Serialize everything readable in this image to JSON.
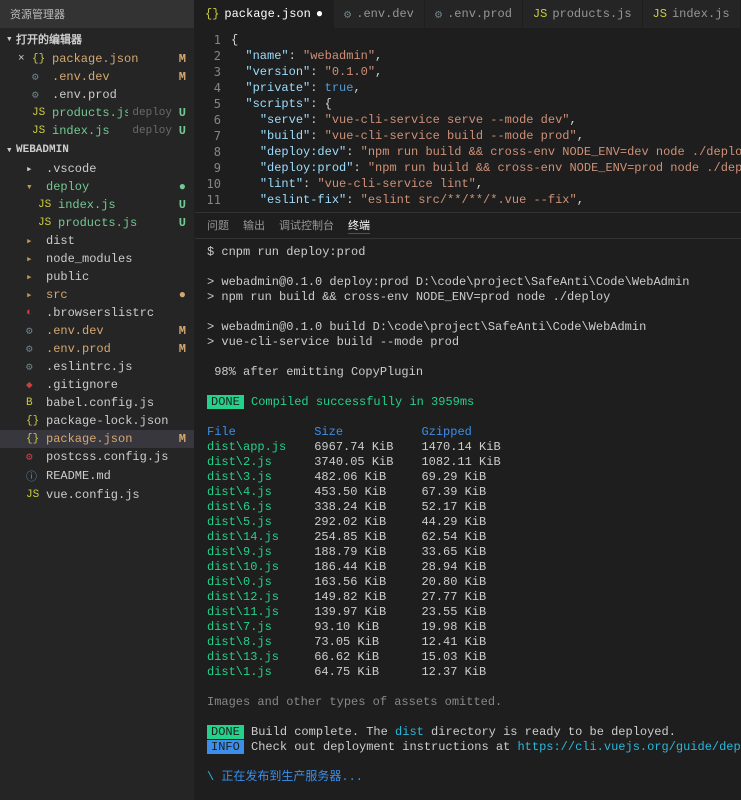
{
  "sidebar": {
    "title": "资源管理器",
    "open_editors_label": "打开的编辑器",
    "project_label": "WEBADMIN",
    "open_editors": [
      {
        "icon": "{}",
        "iconClass": "icon-json",
        "name": "package.json",
        "status": "M",
        "statusClass": "",
        "modClass": "modified",
        "close": "×",
        "suffix": ""
      },
      {
        "icon": "⚙",
        "iconClass": "icon-gear",
        "name": ".env.dev",
        "status": "M",
        "statusClass": "",
        "modClass": "modified",
        "close": "",
        "suffix": ""
      },
      {
        "icon": "⚙",
        "iconClass": "icon-gear",
        "name": ".env.prod",
        "status": "",
        "statusClass": "",
        "modClass": "",
        "close": "",
        "suffix": ""
      },
      {
        "icon": "JS",
        "iconClass": "icon-js",
        "name": "products.js",
        "suffix": "deploy",
        "status": "U",
        "statusClass": "u",
        "modClass": "untracked",
        "close": ""
      },
      {
        "icon": "JS",
        "iconClass": "icon-js",
        "name": "index.js",
        "suffix": "deploy",
        "status": "U",
        "statusClass": "u",
        "modClass": "untracked",
        "close": ""
      }
    ],
    "tree": [
      {
        "depth": "d1",
        "icon": "▸",
        "iconClass": "",
        "name": ".vscode",
        "status": "",
        "statusClass": "",
        "modClass": ""
      },
      {
        "depth": "d1",
        "icon": "▾",
        "iconClass": "icon-folder",
        "name": "deploy",
        "status": "●",
        "statusClass": "u",
        "modClass": "untracked"
      },
      {
        "depth": "d2",
        "icon": "JS",
        "iconClass": "icon-js",
        "name": "index.js",
        "status": "U",
        "statusClass": "u",
        "modClass": "untracked"
      },
      {
        "depth": "d2",
        "icon": "JS",
        "iconClass": "icon-js",
        "name": "products.js",
        "status": "U",
        "statusClass": "u",
        "modClass": "untracked"
      },
      {
        "depth": "d1",
        "icon": "▸",
        "iconClass": "icon-folder",
        "name": "dist",
        "status": "",
        "statusClass": "",
        "modClass": ""
      },
      {
        "depth": "d1",
        "icon": "▸",
        "iconClass": "icon-folder",
        "name": "node_modules",
        "status": "",
        "statusClass": "",
        "modClass": ""
      },
      {
        "depth": "d1",
        "icon": "▸",
        "iconClass": "icon-folder",
        "name": "public",
        "status": "",
        "statusClass": "",
        "modClass": ""
      },
      {
        "depth": "d1",
        "icon": "▸",
        "iconClass": "icon-folder",
        "name": "src",
        "status": "●",
        "statusClass": "",
        "modClass": "modified"
      },
      {
        "depth": "d1",
        "icon": "◐",
        "iconClass": "icon-red",
        "name": ".browserslistrc",
        "status": "",
        "statusClass": "",
        "modClass": ""
      },
      {
        "depth": "d1",
        "icon": "⚙",
        "iconClass": "icon-gear",
        "name": ".env.dev",
        "status": "M",
        "statusClass": "",
        "modClass": "modified"
      },
      {
        "depth": "d1",
        "icon": "⚙",
        "iconClass": "icon-gear",
        "name": ".env.prod",
        "status": "M",
        "statusClass": "",
        "modClass": "modified"
      },
      {
        "depth": "d1",
        "icon": "⚙",
        "iconClass": "icon-gear",
        "name": ".eslintrc.js",
        "status": "",
        "statusClass": "",
        "modClass": ""
      },
      {
        "depth": "d1",
        "icon": "◆",
        "iconClass": "icon-red",
        "name": ".gitignore",
        "status": "",
        "statusClass": "",
        "modClass": ""
      },
      {
        "depth": "d1",
        "icon": "B",
        "iconClass": "icon-js",
        "name": "babel.config.js",
        "status": "",
        "statusClass": "",
        "modClass": ""
      },
      {
        "depth": "d1",
        "icon": "{}",
        "iconClass": "icon-json",
        "name": "package-lock.json",
        "status": "",
        "statusClass": "",
        "modClass": ""
      },
      {
        "depth": "d1",
        "icon": "{}",
        "iconClass": "icon-json",
        "name": "package.json",
        "status": "M",
        "statusClass": "",
        "modClass": "modified",
        "active": true
      },
      {
        "depth": "d1",
        "icon": "⚙",
        "iconClass": "icon-red",
        "name": "postcss.config.js",
        "status": "",
        "statusClass": "",
        "modClass": ""
      },
      {
        "depth": "d1",
        "icon": "ⓘ",
        "iconClass": "icon-blue",
        "name": "README.md",
        "status": "",
        "statusClass": "",
        "modClass": ""
      },
      {
        "depth": "d1",
        "icon": "JS",
        "iconClass": "icon-js",
        "name": "vue.config.js",
        "status": "",
        "statusClass": "",
        "modClass": ""
      }
    ]
  },
  "tabs": [
    {
      "icon": "{}",
      "iconClass": "icon-json",
      "label": "package.json",
      "active": true,
      "dot": "●"
    },
    {
      "icon": "⚙",
      "iconClass": "icon-gear",
      "label": ".env.dev",
      "active": false,
      "dot": ""
    },
    {
      "icon": "⚙",
      "iconClass": "icon-gear",
      "label": ".env.prod",
      "active": false,
      "dot": ""
    },
    {
      "icon": "JS",
      "iconClass": "icon-js",
      "label": "products.js",
      "active": false,
      "dot": ""
    },
    {
      "icon": "JS",
      "iconClass": "icon-js",
      "label": "index.js",
      "active": false,
      "dot": ""
    }
  ],
  "editor": {
    "lines": [
      {
        "n": "1",
        "html": "<span class='c-punc'>{</span>"
      },
      {
        "n": "2",
        "html": "  <span class='c-key'>\"name\"</span><span class='c-punc'>: </span><span class='c-str'>\"webadmin\"</span><span class='c-punc'>,</span>"
      },
      {
        "n": "3",
        "html": "  <span class='c-key'>\"version\"</span><span class='c-punc'>: </span><span class='c-str'>\"0.1.0\"</span><span class='c-punc'>,</span>"
      },
      {
        "n": "4",
        "html": "  <span class='c-key'>\"private\"</span><span class='c-punc'>: </span><span class='c-bool'>true</span><span class='c-punc'>,</span>"
      },
      {
        "n": "5",
        "html": "  <span class='c-key'>\"scripts\"</span><span class='c-punc'>: {</span>"
      },
      {
        "n": "6",
        "html": "    <span class='c-key'>\"serve\"</span><span class='c-punc'>: </span><span class='c-str'>\"vue-cli-service serve --mode dev\"</span><span class='c-punc'>,</span>"
      },
      {
        "n": "7",
        "html": "    <span class='c-key'>\"build\"</span><span class='c-punc'>: </span><span class='c-str'>\"vue-cli-service build --mode prod\"</span><span class='c-punc'>,</span>"
      },
      {
        "n": "8",
        "html": "    <span class='c-key'>\"deploy:dev\"</span><span class='c-punc'>: </span><span class='c-str'>\"npm run build && cross-env NODE_ENV=dev node ./deploy\"</span><span class='c-punc'>,</span>"
      },
      {
        "n": "9",
        "html": "    <span class='c-key'>\"deploy:prod\"</span><span class='c-punc'>: </span><span class='c-str'>\"npm run build && cross-env NODE_ENV=prod node ./deploy\"</span><span class='c-punc'>,</span>"
      },
      {
        "n": "10",
        "html": "    <span class='c-key'>\"lint\"</span><span class='c-punc'>: </span><span class='c-str'>\"vue-cli-service lint\"</span><span class='c-punc'>,</span>"
      },
      {
        "n": "11",
        "html": "    <span class='c-key'>\"eslint-fix\"</span><span class='c-punc'>: </span><span class='c-str'>\"eslint src/**/**/*.vue --fix\"</span><span class='c-punc'>,</span>"
      }
    ]
  },
  "terminal_tabs": {
    "t1": "问题",
    "t2": "输出",
    "t3": "调试控制台",
    "t4": "终端"
  },
  "terminal": {
    "cmd": "$ cnpm run deploy:prod",
    "line1": "> webadmin@0.1.0 deploy:prod D:\\code\\project\\SafeAnti\\Code\\WebAdmin",
    "line2": "> npm run build && cross-env NODE_ENV=prod node ./deploy",
    "line3": "> webadmin@0.1.0 build D:\\code\\project\\SafeAnti\\Code\\WebAdmin",
    "line4": "> vue-cli-service build --mode prod",
    "progress": " 98% after emitting CopyPlugin",
    "done_label": "DONE",
    "compiled": " Compiled successfully in 3959ms",
    "header_file": "File",
    "header_size": "Size",
    "header_gzip": "Gzipped",
    "files": [
      {
        "f": "dist\\app.js",
        "s": "6967.74 KiB",
        "g": "1470.14 KiB"
      },
      {
        "f": "dist\\2.js",
        "s": "3740.05 KiB",
        "g": "1082.11 KiB"
      },
      {
        "f": "dist\\3.js",
        "s": "482.06 KiB",
        "g": "69.29 KiB"
      },
      {
        "f": "dist\\4.js",
        "s": "453.50 KiB",
        "g": "67.39 KiB"
      },
      {
        "f": "dist\\6.js",
        "s": "338.24 KiB",
        "g": "52.17 KiB"
      },
      {
        "f": "dist\\5.js",
        "s": "292.02 KiB",
        "g": "44.29 KiB"
      },
      {
        "f": "dist\\14.js",
        "s": "254.85 KiB",
        "g": "62.54 KiB"
      },
      {
        "f": "dist\\9.js",
        "s": "188.79 KiB",
        "g": "33.65 KiB"
      },
      {
        "f": "dist\\10.js",
        "s": "186.44 KiB",
        "g": "28.94 KiB"
      },
      {
        "f": "dist\\0.js",
        "s": "163.56 KiB",
        "g": "20.80 KiB"
      },
      {
        "f": "dist\\12.js",
        "s": "149.82 KiB",
        "g": "27.77 KiB"
      },
      {
        "f": "dist\\11.js",
        "s": "139.97 KiB",
        "g": "23.55 KiB"
      },
      {
        "f": "dist\\7.js",
        "s": "93.10 KiB",
        "g": "19.98 KiB"
      },
      {
        "f": "dist\\8.js",
        "s": "73.05 KiB",
        "g": "12.41 KiB"
      },
      {
        "f": "dist\\13.js",
        "s": "66.62 KiB",
        "g": "15.03 KiB"
      },
      {
        "f": "dist\\1.js",
        "s": "64.75 KiB",
        "g": "12.37 KiB"
      }
    ],
    "omitted": "Images and other types of assets omitted.",
    "build_complete_1": " Build complete. The ",
    "build_complete_dist": "dist",
    "build_complete_2": " directory is ready to be deployed.",
    "info_label": "INFO",
    "info_text": " Check out deployment instructions at ",
    "info_url": "https://cli.vuejs.org/guide/deployment.html",
    "spinner": "\\ ",
    "publishing": "正在发布到生产服务器..."
  }
}
